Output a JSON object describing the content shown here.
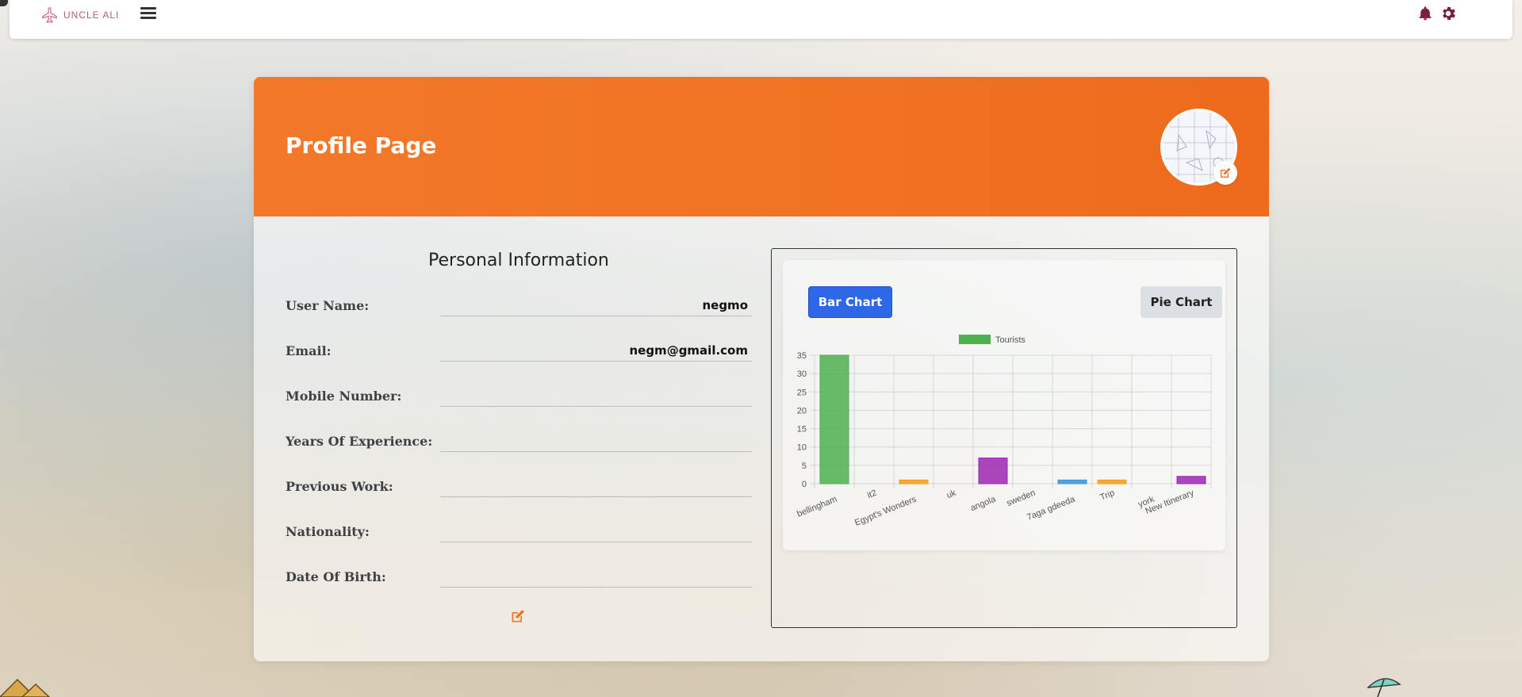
{
  "nav": {
    "brand": "UNCLE ALI",
    "icons": [
      "plane-icon",
      "hamburger-icon",
      "bell-icon",
      "gear-icon"
    ],
    "accent": "#7a1f3d"
  },
  "profile": {
    "banner_title": "Profile Page",
    "banner_color": "#f07423",
    "section_title": "Personal Information",
    "fields": [
      {
        "label": "User Name:",
        "value": "negmo"
      },
      {
        "label": "Email:",
        "value": "negm@gmail.com"
      },
      {
        "label": "Mobile Number:",
        "value": ""
      },
      {
        "label": "Years Of Experience:",
        "value": ""
      },
      {
        "label": "Previous Work:",
        "value": ""
      },
      {
        "label": "Nationality:",
        "value": ""
      },
      {
        "label": "Date Of Birth:",
        "value": ""
      }
    ]
  },
  "chart_buttons": {
    "bar": "Bar Chart",
    "pie": "Pie Chart",
    "active": "bar",
    "active_color": "#2f68e6"
  },
  "chart_data": {
    "type": "bar",
    "categories": [
      "bellingham",
      "it2",
      "Egypt's Wonders",
      "uk",
      "angola",
      "sweden",
      "7aga gdeeda",
      "Trip",
      "york",
      "New Itinerary"
    ],
    "series": [
      {
        "name": "Tourists",
        "values": [
          35,
          0,
          1,
          0,
          7,
          0,
          1,
          1,
          0,
          2
        ]
      }
    ],
    "bar_colors": [
      "#4caf50",
      "#3498db",
      "#f39c12",
      "#9b59b6",
      "#9c27b0",
      "#3498db",
      "#3498db",
      "#f39c12",
      "#3498db",
      "#9c27b0"
    ],
    "legend_color": "#4caf50",
    "ylim": [
      0,
      35
    ],
    "yticks": [
      0,
      5,
      10,
      15,
      20,
      25,
      30,
      35
    ],
    "legend": "top",
    "grid": true
  }
}
